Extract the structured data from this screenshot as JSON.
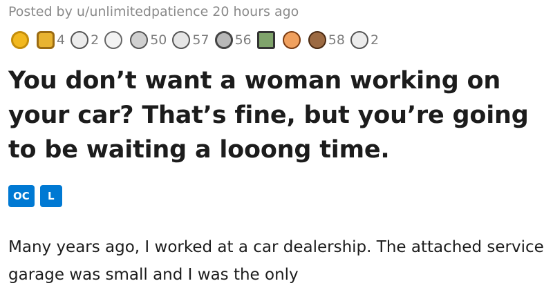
{
  "post": {
    "meta": "Posted by u/unlimitedpatience 20 hours ago",
    "awards": [
      {
        "icon": "gold-award-icon",
        "count": "",
        "color": "#f2b81e"
      },
      {
        "icon": "hexagon-award-icon",
        "count": "4",
        "color": "#e8b331"
      },
      {
        "icon": "snoo-award-icon",
        "count": "2",
        "color": "#c9c9c9"
      },
      {
        "icon": "face-award-icon",
        "count": "",
        "color": "#d8d8d8"
      },
      {
        "icon": "hand-award-icon",
        "count": "50",
        "color": "#b0b0b0"
      },
      {
        "icon": "laugh-award-icon",
        "count": "57",
        "color": "#cfcfcf"
      },
      {
        "icon": "silver-award-icon",
        "count": "56",
        "color": "#8f8f8f"
      },
      {
        "icon": "picture-award-icon",
        "count": "",
        "color": "#6b8f5a"
      },
      {
        "icon": "snoo-pirate-award-icon",
        "count": "",
        "color": "#e07a3a"
      },
      {
        "icon": "bear-award-icon",
        "count": "58",
        "color": "#8a5a35"
      },
      {
        "icon": "snoo-award-icon",
        "count": "2",
        "color": "#c9c9c9"
      }
    ],
    "title": "You don’t want a woman working on your car? That’s fine, but you’re going to be waiting a looong time.",
    "flairs": [
      "OC",
      "L"
    ],
    "body": "Many years ago, I worked at a car dealership. The attached service garage was small and I was the only"
  },
  "colors": {
    "flair_bg": "#0079d3",
    "meta_text": "#8a8a8a",
    "title_text": "#1c1c1c"
  }
}
